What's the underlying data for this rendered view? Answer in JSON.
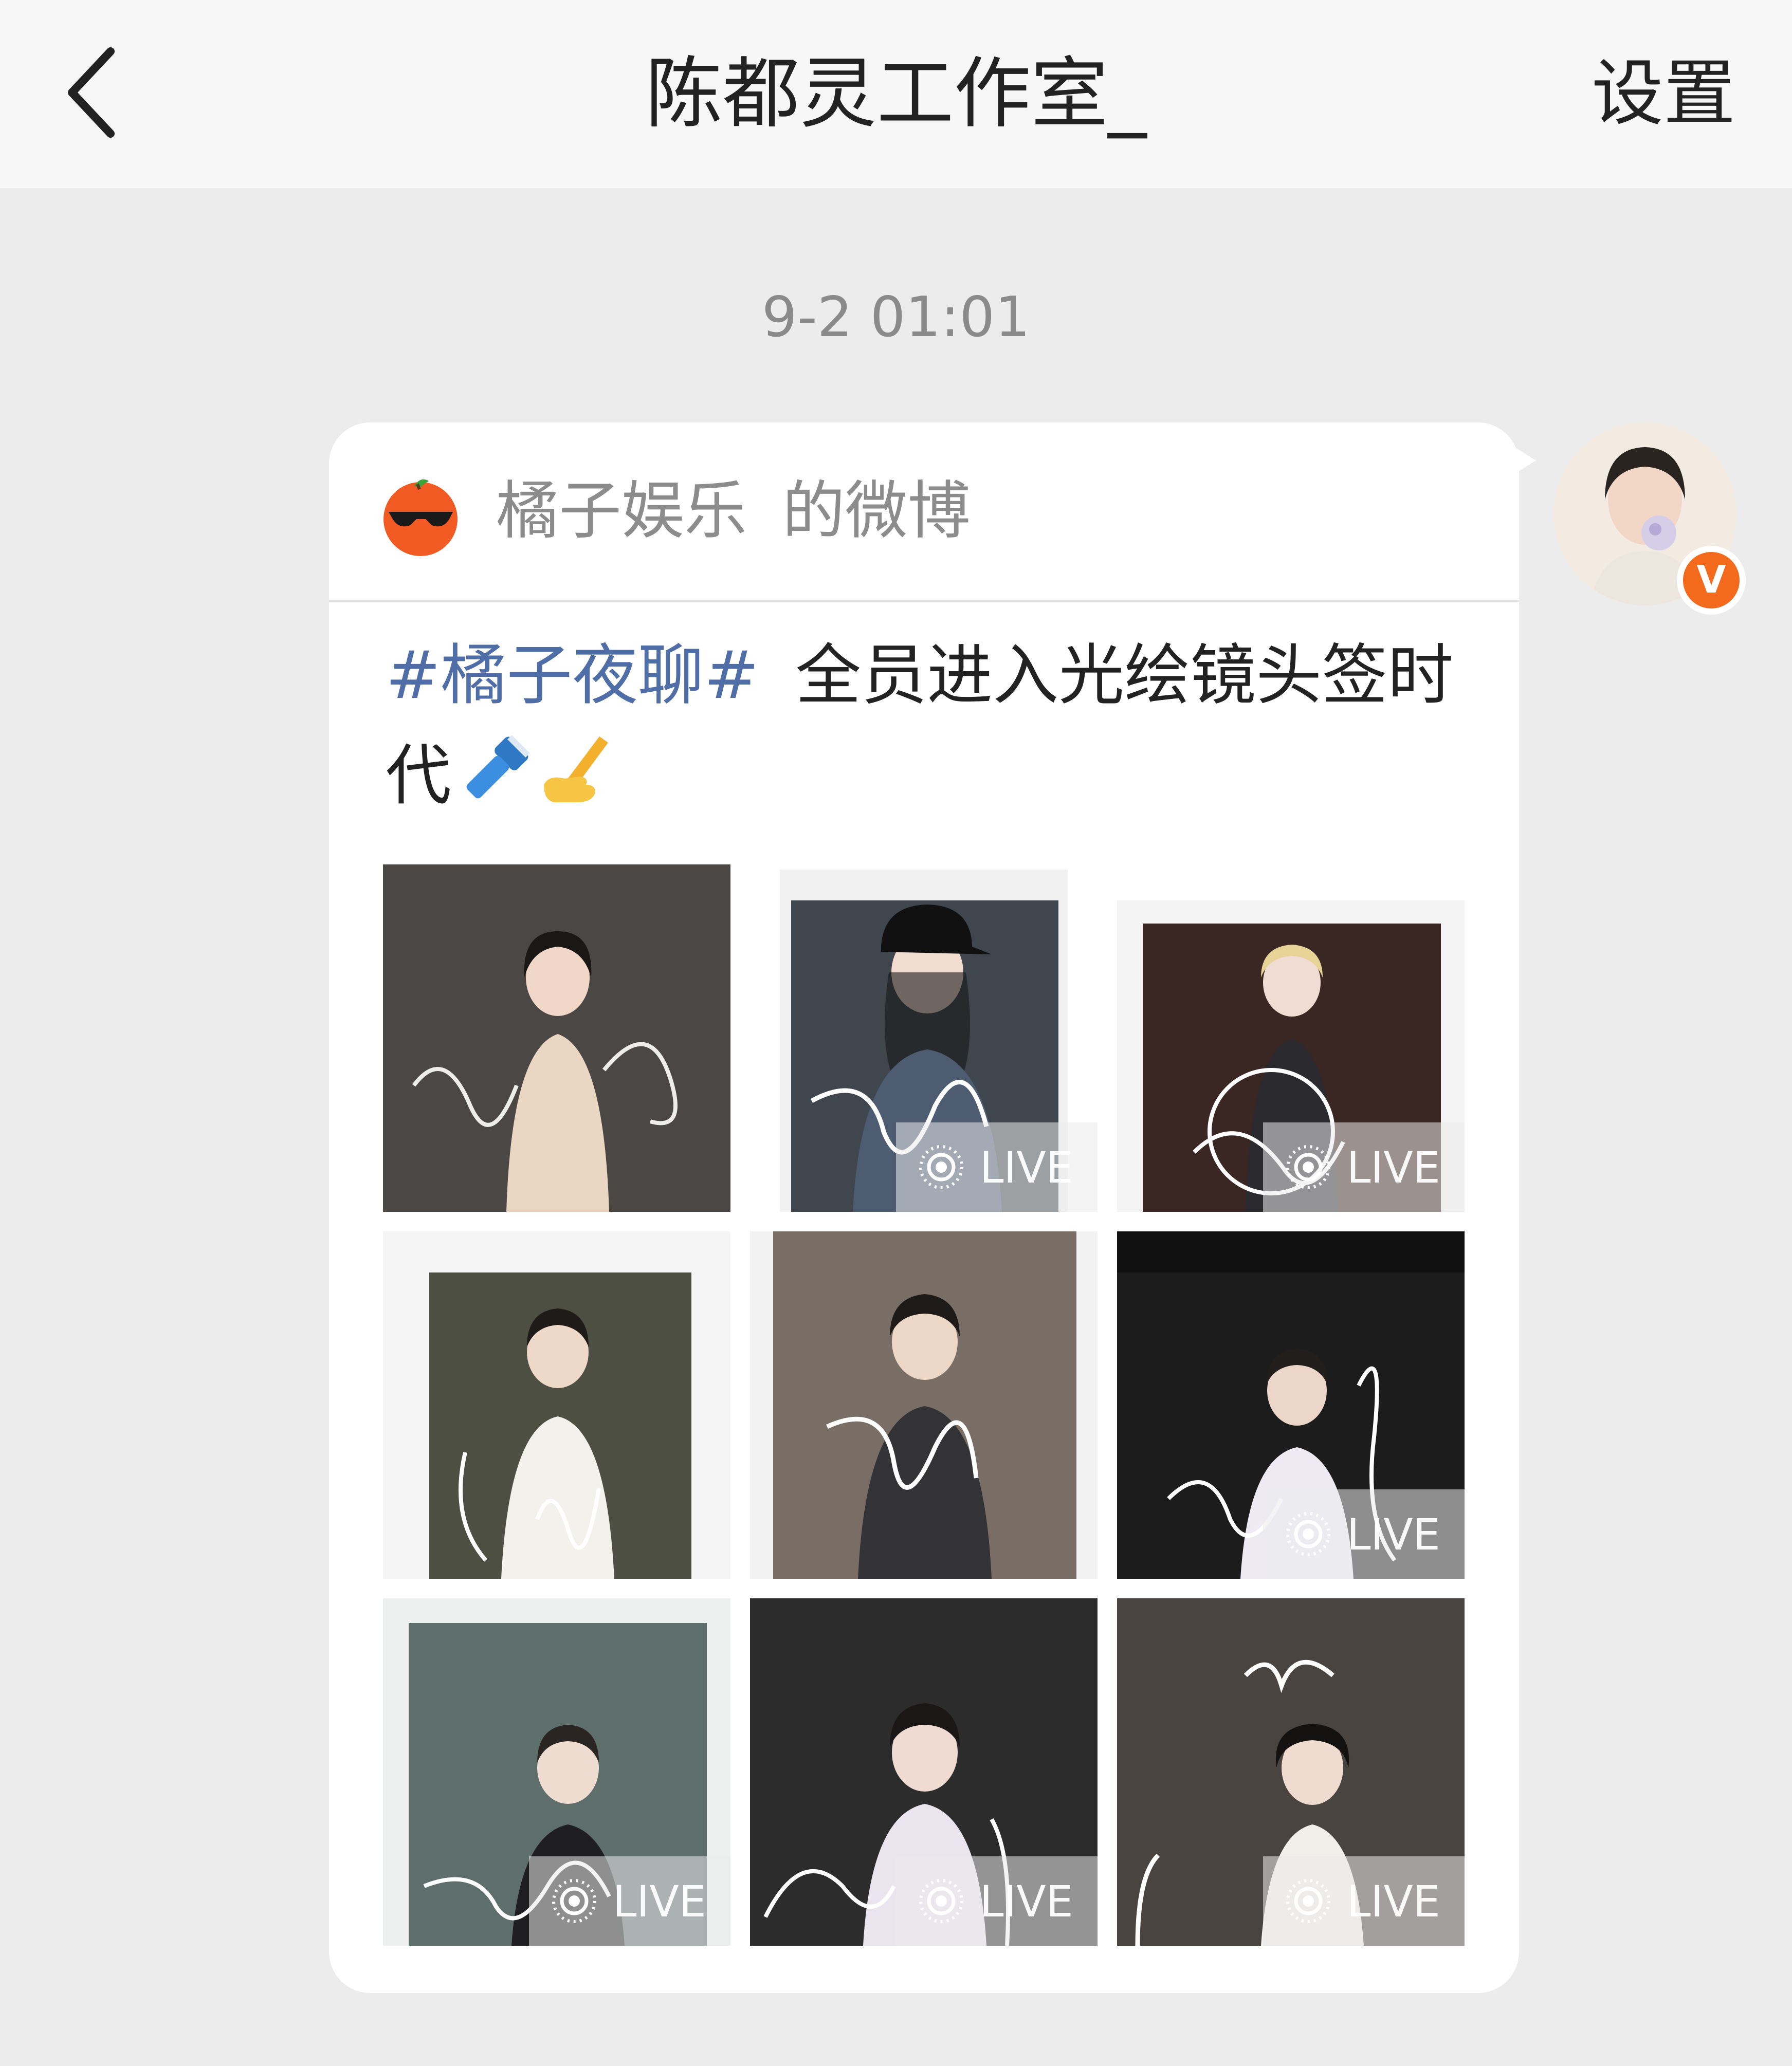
{
  "header": {
    "title": "陈都灵工作室_",
    "settings_label": "设置",
    "back_icon": "chevron-left-icon"
  },
  "message": {
    "timestamp": "9-2 01:01",
    "source_account": "橘子娱乐",
    "source_suffix": "的微博",
    "hashtag": "#橘子夜聊#",
    "body_text": "全员进入光绘镜头签时代",
    "emojis": [
      "flashlight-icon",
      "writing-hand-icon"
    ]
  },
  "photos": [
    {
      "live": false
    },
    {
      "live": true,
      "label": "LIVE"
    },
    {
      "live": true,
      "label": "LIVE"
    },
    {
      "live": false
    },
    {
      "live": false
    },
    {
      "live": true,
      "label": "LIVE"
    },
    {
      "live": true,
      "label": "LIVE"
    },
    {
      "live": true,
      "label": "LIVE"
    },
    {
      "live": true,
      "label": "LIVE"
    }
  ],
  "live_labels": {
    "p2": "LIVE",
    "p3": "LIVE",
    "p6": "LIVE",
    "p7": "LIVE",
    "p8": "LIVE",
    "p9": "LIVE"
  },
  "badge": {
    "verified_label": "V"
  },
  "colors": {
    "hashtag": "#4f6da6",
    "verified_badge": "#f46a1c",
    "background": "#ececec"
  }
}
